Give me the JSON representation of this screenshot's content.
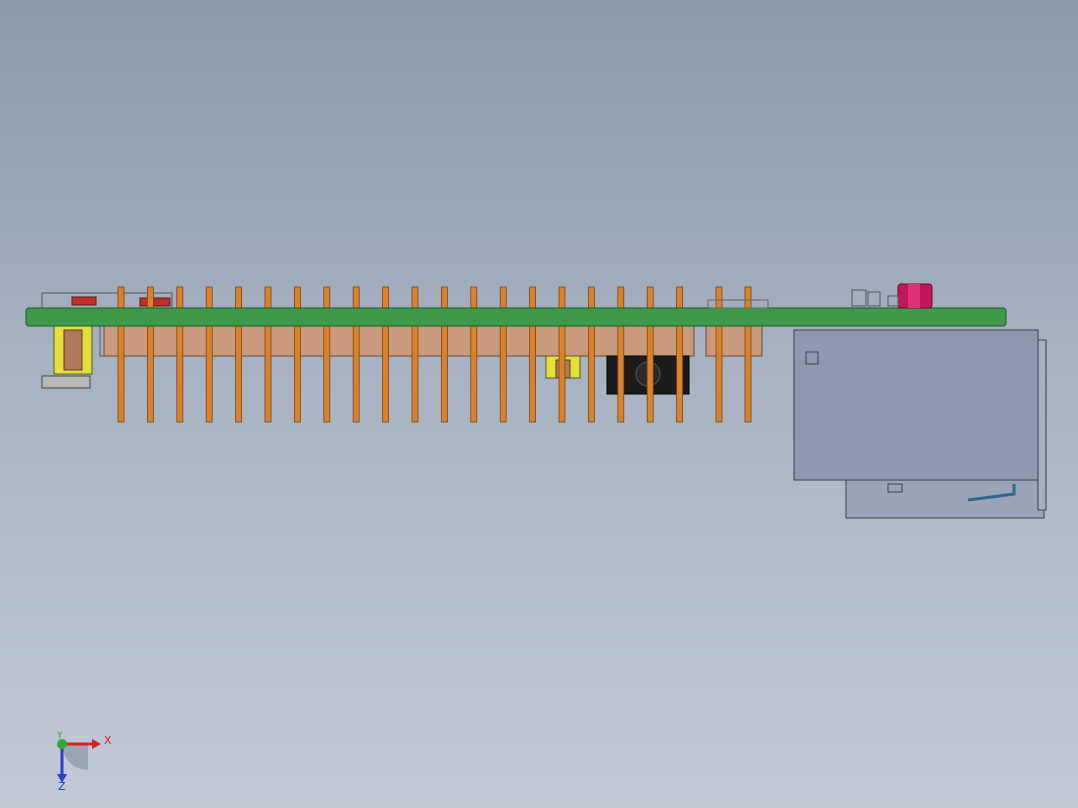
{
  "viewport": {
    "background_top": "#8a9aad",
    "background_bottom": "#c3cad6"
  },
  "model": {
    "pcb_color": "#3e9a4a",
    "pin_color": "#d9822b",
    "header_body_color": "#c99a7e",
    "button_accent": "#c2185b",
    "clip_color": "#e3e03a",
    "connector_color": "#8e99b0"
  },
  "triad": {
    "x_label": "X",
    "y_label": "Y",
    "z_label": "Z",
    "x_color": "#d8202a",
    "y_color": "#2faa3a",
    "z_color": "#2a3fd0"
  }
}
